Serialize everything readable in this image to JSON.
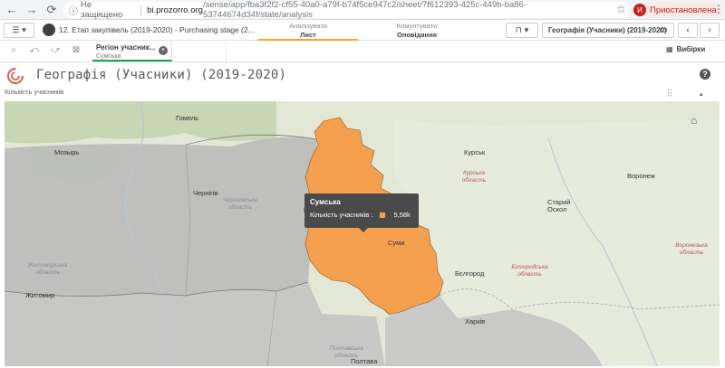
{
  "browser": {
    "insecure_label": "Не защищено",
    "url_host": "bi.prozorro.org",
    "url_path": "/sense/app/fba3f2f2-cf55-40a0-a79f-b74f5ce947c2/sheet/7f612393-425c-449b-ba86-53744674d34f/state/analysis",
    "profile_initial": "И",
    "profile_label": "Приостановлена"
  },
  "toolbar": {
    "app_title": "12. Етап закупівель (2019-2020) - Purchasing stage (2...",
    "tabs": [
      {
        "sub": "Аналізувати",
        "main": "Лист"
      },
      {
        "sub": "Комунтувати",
        "main": "Оповідання"
      }
    ],
    "sheet_select": "Географія (Учасники) (2019-2020)"
  },
  "selections": {
    "chip_field": "Регіон учасник...",
    "chip_value": "Сумська",
    "selections_label": "Вибірки"
  },
  "sheet": {
    "title": "Географія (Учасники) (2019-2020)",
    "chart_subtitle": "Кількість учасників"
  },
  "map": {
    "cities": [
      "Гомель",
      "Мозырь",
      "Чернігів",
      "Курськ",
      "Воронеж",
      "Старий Оскол",
      "Суми",
      "Бєлгород",
      "Житомир",
      "Харків",
      "Полтава"
    ],
    "regions": [
      "Чернігівська область",
      "Курська область",
      "Білгородська область",
      "Воронезька область",
      "Житомирська область",
      "Полтавська область"
    ],
    "highlight_color": "#f4a04f"
  },
  "tooltip": {
    "title": "Сумська",
    "label": "Кількість учасників :",
    "value": "5,58k"
  }
}
